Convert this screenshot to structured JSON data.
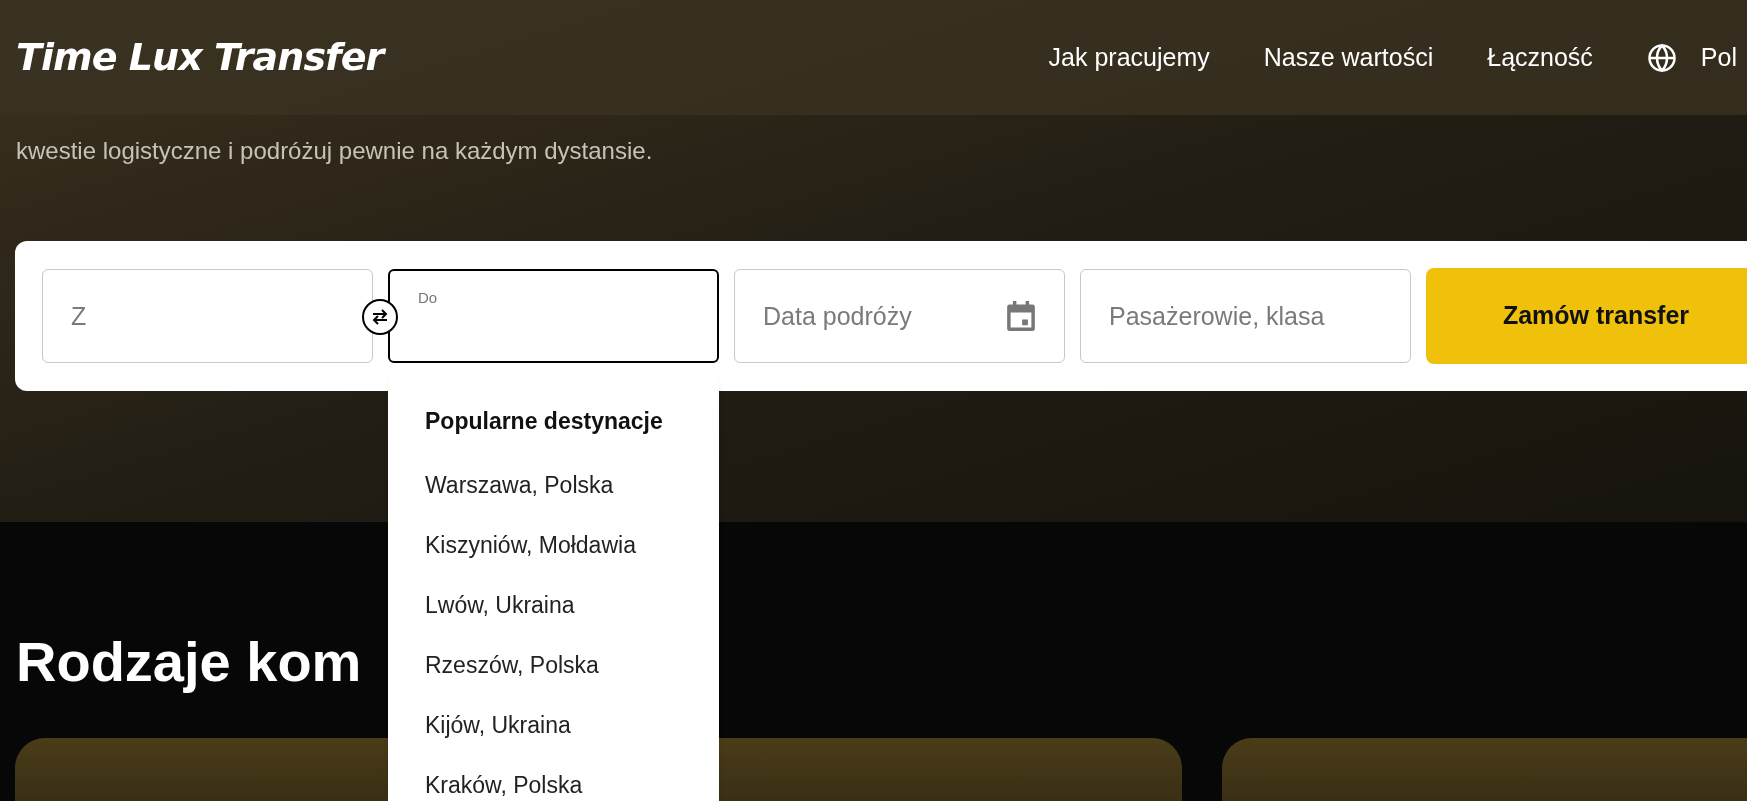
{
  "header": {
    "logo": "Time Lux Transfer",
    "nav": [
      {
        "label": "Jak pracujemy"
      },
      {
        "label": "Nasze wartości"
      },
      {
        "label": "Łączność"
      }
    ],
    "language": "Pol"
  },
  "hero": {
    "text": "kwestie logistyczne i podróżuj pewnie na każdym dystansie."
  },
  "booking": {
    "fields": [
      {
        "kind": "text",
        "placeholder": "Z",
        "focused": false
      },
      {
        "kind": "floating",
        "label": "Do",
        "focused": true
      },
      {
        "kind": "date",
        "placeholder": "Data podróży",
        "focused": false
      },
      {
        "kind": "text",
        "placeholder": "Pasażerowie, klasa",
        "focused": false
      }
    ],
    "submit": "Zamów transfer"
  },
  "dropdown": {
    "title": "Popularne destynacje",
    "items": [
      "Warszawa, Polska",
      "Kiszyniów, Mołdawia",
      "Lwów, Ukraina",
      "Rzeszów, Polska",
      "Kijów, Ukraina",
      "Kraków, Polska"
    ]
  },
  "section": {
    "title": "Rodzaje kom"
  }
}
